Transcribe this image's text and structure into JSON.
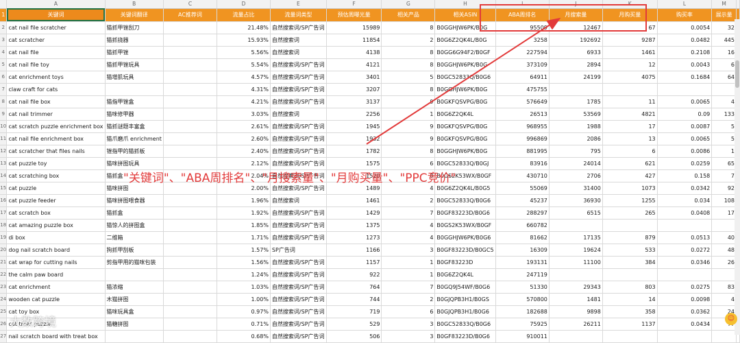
{
  "columns": [
    "A",
    "B",
    "C",
    "D",
    "E",
    "F",
    "G",
    "H",
    "I",
    "J",
    "K",
    "L",
    "M"
  ],
  "headers": [
    "关键词",
    "关键词翻译",
    "AC推荐词",
    "流量占比",
    "流量词类型",
    "预估周曝光量",
    "相关产品",
    "相关ASIN",
    "ABA周排名",
    "月搜索量",
    "月购买量",
    "购买率",
    "展示量"
  ],
  "rows": [
    {
      "n": "2",
      "c": [
        "cat nail file scratcher",
        "猫抓甲锉刮刀",
        "",
        "21.48%",
        "自然搜索词/SP广告词",
        "15989",
        "8",
        "B0GGHJW6PK/B0G",
        "95509",
        "12467",
        "67",
        "0.0054",
        "32"
      ]
    },
    {
      "n": "3",
      "c": [
        "cat scratcher",
        "猫抓挠器",
        "",
        "15.93%",
        "自然搜索词",
        "11854",
        "2",
        "B0G6Z2QK4L/B0G",
        "3258",
        "192692",
        "9287",
        "0.0482",
        "445"
      ]
    },
    {
      "n": "4",
      "c": [
        "cat nail file",
        "猫抓甲锉",
        "",
        "5.56%",
        "自然搜索词",
        "4138",
        "8",
        "B0GG6G94F2/B0GF",
        "227594",
        "6933",
        "1461",
        "0.2108",
        "16"
      ]
    },
    {
      "n": "5",
      "c": [
        "cat nail file toy",
        "猫抓甲锉玩具",
        "",
        "5.54%",
        "自然搜索词/SP广告词",
        "4121",
        "8",
        "B0GGHJW6PK/B0G",
        "373109",
        "2894",
        "12",
        "0.0043",
        "6"
      ]
    },
    {
      "n": "6",
      "c": [
        "cat enrichment toys",
        "猫增肌玩具",
        "",
        "4.57%",
        "自然搜索词/SP广告词",
        "3401",
        "5",
        "B0GC52833Q/B0G6",
        "64911",
        "24199",
        "4075",
        "0.1684",
        "64"
      ]
    },
    {
      "n": "7",
      "c": [
        "claw craft for cats",
        "",
        "",
        "4.31%",
        "自然搜索词/SP广告词",
        "3207",
        "8",
        "B0GGHJW6PK/B0G",
        "475755",
        "",
        "",
        "",
        ""
      ]
    },
    {
      "n": "8",
      "c": [
        "cat nail file box",
        "猫指甲锉盒",
        "",
        "4.21%",
        "自然搜索词/SP广告词",
        "3137",
        "9",
        "B0GKFQSVPG/B0G",
        "576649",
        "1785",
        "11",
        "0.0065",
        "4"
      ]
    },
    {
      "n": "9",
      "c": [
        "cat nail trimmer",
        "猫咪修甲器",
        "",
        "3.03%",
        "自然搜索词",
        "2256",
        "1",
        "B0G6Z2QK4L",
        "26513",
        "53569",
        "4821",
        "0.09",
        "133"
      ]
    },
    {
      "n": "10",
      "c": [
        "cat scratch puzzle enrichment box",
        "猫抓谜题丰富盒",
        "",
        "2.61%",
        "自然搜索词/SP广告词",
        "1945",
        "9",
        "B0GKFQSVPG/B0G",
        "968955",
        "1988",
        "17",
        "0.0087",
        "5"
      ]
    },
    {
      "n": "11",
      "c": [
        "cat nail file enrichment box",
        "猫爪磨爪 enrichment",
        "",
        "2.60%",
        "自然搜索词/SP广告词",
        "1932",
        "9",
        "B0GKFQSVPG/B0G",
        "996869",
        "2086",
        "13",
        "0.0065",
        "5"
      ]
    },
    {
      "n": "12",
      "c": [
        "cat scratcher that files nails",
        "锉指甲的猫抓板",
        "",
        "2.40%",
        "自然搜索词/SP广告词",
        "1782",
        "8",
        "B0GGHJW6PK/B0G",
        "881995",
        "795",
        "6",
        "0.0086",
        "1"
      ]
    },
    {
      "n": "13",
      "c": [
        "cat puzzle toy",
        "猫咪拼图玩具",
        "",
        "2.12%",
        "自然搜索词/SP广告词",
        "1575",
        "6",
        "B0GC52833Q/B0GJ",
        "83916",
        "24014",
        "621",
        "0.0259",
        "65"
      ]
    },
    {
      "n": "14",
      "c": [
        "cat scratching box",
        "猫抓盒",
        "",
        "2.04%",
        "自然搜索词/SP广告词",
        "1520",
        "8",
        "B0GS2K53WX/B0GF",
        "430710",
        "2706",
        "427",
        "0.158",
        "7"
      ]
    },
    {
      "n": "15",
      "c": [
        "cat puzzle",
        "猫咪拼图",
        "",
        "2.00%",
        "自然搜索词/SP广告词",
        "1489",
        "4",
        "B0G6Z2QK4L/B0G5",
        "55069",
        "31400",
        "1073",
        "0.0342",
        "92"
      ]
    },
    {
      "n": "16",
      "c": [
        "cat puzzle feeder",
        "猫咪拼图喂食器",
        "",
        "1.96%",
        "自然搜索词",
        "1461",
        "2",
        "B0GC52833Q/B0G6",
        "45237",
        "36930",
        "1255",
        "0.034",
        "108"
      ]
    },
    {
      "n": "17",
      "c": [
        "cat scratch box",
        "猫抓盒",
        "",
        "1.92%",
        "自然搜索词/SP广告词",
        "1429",
        "7",
        "B0GF83223D/B0G6",
        "288297",
        "6515",
        "265",
        "0.0408",
        "17"
      ]
    },
    {
      "n": "18",
      "c": [
        "cat amazing puzzle box",
        "猫惊人的拼图盒",
        "",
        "1.85%",
        "自然搜索词/SP广告词",
        "1375",
        "4",
        "B0GS2K53WX/B0GF",
        "660782",
        "",
        "",
        "",
        ""
      ]
    },
    {
      "n": "19",
      "c": [
        "di box",
        "二维箱",
        "",
        "1.71%",
        "自然搜索词/SP广告词",
        "1273",
        "4",
        "B0GGHJW6PK/B0G6",
        "81662",
        "17135",
        "879",
        "0.0513",
        "40"
      ]
    },
    {
      "n": "20",
      "c": [
        "dog nail scratch board",
        "狗抓甲刮板",
        "",
        "1.57%",
        "SP广告词",
        "1166",
        "3",
        "B0GF83223D/B0GC5",
        "16309",
        "19624",
        "533",
        "0.0272",
        "48"
      ]
    },
    {
      "n": "21",
      "c": [
        "cat wrap for cutting nails",
        "剪指甲用的猫咪包装",
        "",
        "1.56%",
        "自然搜索词/SP广告词",
        "1157",
        "1",
        "B0GF83223D",
        "193131",
        "11100",
        "384",
        "0.0346",
        "26"
      ]
    },
    {
      "n": "22",
      "c": [
        "the calm paw board",
        "",
        "",
        "1.24%",
        "自然搜索词/SP广告词",
        "922",
        "1",
        "B0G6Z2QK4L",
        "247119",
        "",
        "",
        "",
        ""
      ]
    },
    {
      "n": "23",
      "c": [
        "cat enrichment",
        "猫浓缩",
        "",
        "1.03%",
        "自然搜索词/SP广告词",
        "764",
        "7",
        "B0GQ9J54WF/B0G6",
        "51330",
        "29343",
        "803",
        "0.0275",
        "83"
      ]
    },
    {
      "n": "24",
      "c": [
        "wooden cat puzzle",
        "木猫拼图",
        "",
        "1.00%",
        "自然搜索词/SP广告词",
        "744",
        "2",
        "B0GJQPB3H1/B0GS",
        "570800",
        "1481",
        "14",
        "0.0098",
        "4"
      ]
    },
    {
      "n": "25",
      "c": [
        "cat toy box",
        "猫咪玩具盒",
        "",
        "0.97%",
        "自然搜索词/SP广告词",
        "719",
        "6",
        "B0GJQPB3H1/B0G6",
        "182688",
        "9898",
        "358",
        "0.0362",
        "24"
      ]
    },
    {
      "n": "26",
      "c": [
        "cat treat puzzle",
        "猫糖拼图",
        "",
        "0.71%",
        "自然搜索词/SP广告词",
        "529",
        "3",
        "B0GC52833Q/B0G6",
        "75925",
        "26211",
        "1137",
        "0.0434",
        "77"
      ]
    },
    {
      "n": "27",
      "c": [
        "nail scratch board with treat box",
        "",
        "",
        "0.68%",
        "自然搜索词/SP广告词",
        "506",
        "3",
        "B0GF83223D/B0G6",
        "910011",
        "",
        "",
        "",
        ""
      ]
    }
  ],
  "annotation": "\"关键词\"、\"ABA周排名\"、\"月搜索量\"、\"月购买量\"、\"PPC竞价\"",
  "watermark": "大数跨境",
  "colors": {
    "header": "#f09421",
    "highlight": "#e23a3a",
    "grid": "#d9d9d9"
  }
}
